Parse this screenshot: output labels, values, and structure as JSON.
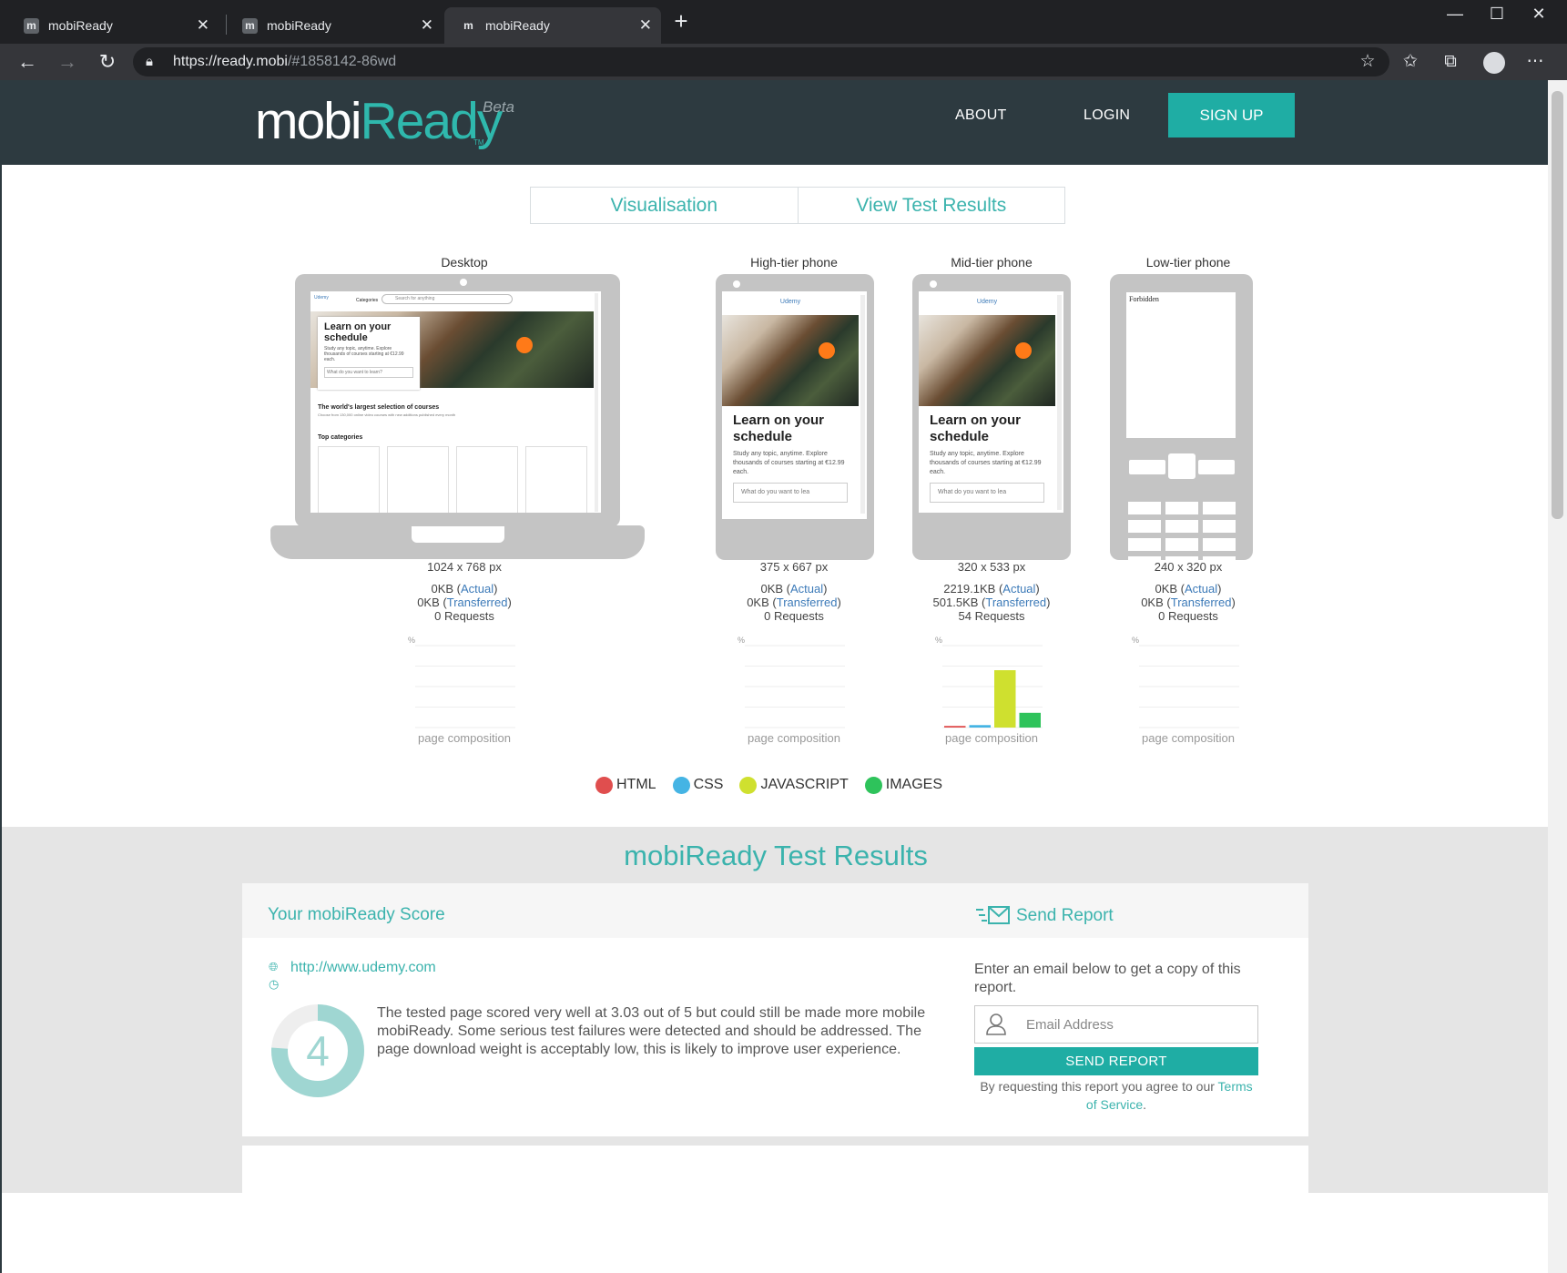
{
  "browser": {
    "tabs": [
      {
        "favicon": "m",
        "title": "mobiReady"
      },
      {
        "favicon": "m",
        "title": "mobiReady"
      },
      {
        "favicon": "m",
        "title": "mobiReady"
      }
    ],
    "url_host": "https://ready.mobi",
    "url_path": "/#1858142-86wd"
  },
  "header": {
    "logo_mobi": "mobi",
    "logo_ready": "Ready",
    "logo_tm": "TM",
    "logo_beta": "Beta",
    "nav_about": "ABOUT",
    "nav_login": "LOGIN",
    "nav_signup": "SIGN UP"
  },
  "view_tabs": {
    "visualisation": "Visualisation",
    "results": "View Test Results"
  },
  "devices": [
    {
      "label": "Desktop",
      "resolution": "1024 x 768 px",
      "actual": "0KB",
      "transferred": "0KB",
      "requests": "0 Requests",
      "composition": [
        0,
        0,
        0,
        0
      ]
    },
    {
      "label": "High-tier phone",
      "resolution": "375 x 667 px",
      "actual": "0KB",
      "transferred": "0KB",
      "requests": "0 Requests",
      "composition": [
        0,
        0,
        0,
        0
      ]
    },
    {
      "label": "Mid-tier phone",
      "resolution": "320 x 533 px",
      "actual": "2219.1KB",
      "transferred": "501.5KB",
      "requests": "54 Requests",
      "composition": [
        2,
        3,
        70,
        18
      ]
    },
    {
      "label": "Low-tier phone",
      "resolution": "240 x 320 px",
      "actual": "0KB",
      "transferred": "0KB",
      "requests": "0 Requests",
      "composition": [
        0,
        0,
        0,
        0
      ]
    }
  ],
  "stat_words": {
    "actual": "Actual",
    "transferred": "Transferred",
    "composition": "page composition",
    "axis_unit": "%"
  },
  "preview": {
    "logo_alt": "Udemy",
    "categories": "Categories",
    "search_placeholder": "Search for anything",
    "hero_title": "Learn on your schedule",
    "hero_sub": "Study any topic, anytime. Explore thousands of courses starting at €12.99 each.",
    "hero_input": "What do you want to learn?",
    "mobile_input": "What do you want to lea",
    "largest": "The world's largest selection of courses",
    "largest_sub": "Choose from 130,000 online video courses with new additions published every month",
    "top_categories": "Top categories",
    "forbidden": "Forbidden"
  },
  "legend": [
    {
      "label": "HTML",
      "color": "#e04e4e"
    },
    {
      "label": "CSS",
      "color": "#45b4e4"
    },
    {
      "label": "JAVASCRIPT",
      "color": "#cfe02f"
    },
    {
      "label": "IMAGES",
      "color": "#2ec35b"
    }
  ],
  "results": {
    "title": "mobiReady Test Results",
    "score_title": "Your mobiReady Score",
    "send_title": "Send Report",
    "site_url": "http://www.udemy.com",
    "score": "4",
    "score_fraction": 0.76,
    "score_text": "The tested page scored very well at 3.03 out of 5 but could still be made more mobile mobiReady. Some serious test failures were detected and should be addressed. The page download weight is acceptably low, this is likely to improve user experience.",
    "email_prompt": "Enter an email below to get a copy of this report.",
    "email_placeholder": "Email Address",
    "send_button": "SEND REPORT",
    "terms_prefix": "By requesting this report you agree to our",
    "terms_link": "Terms of Service",
    "terms_suffix": "."
  },
  "colors": {
    "accent": "#1fada4",
    "header_bg": "#2d3a40",
    "teal_text": "#3bb3ad"
  }
}
